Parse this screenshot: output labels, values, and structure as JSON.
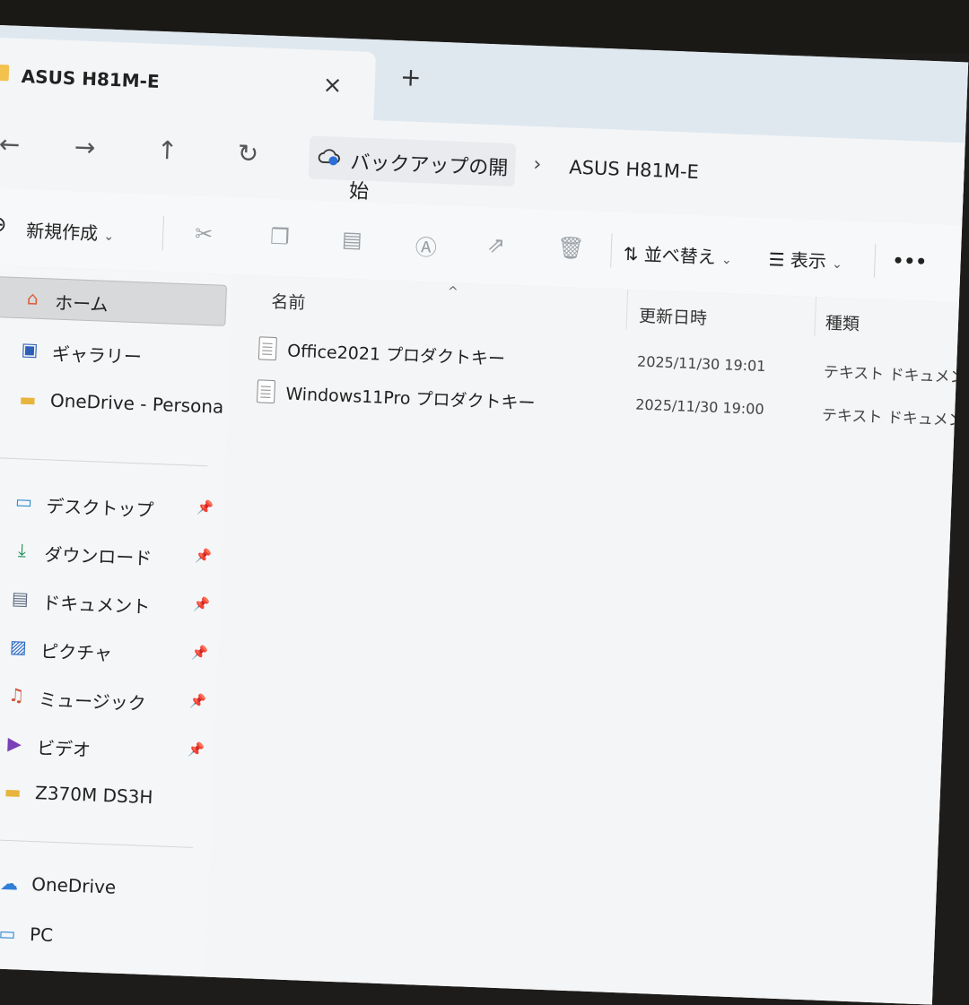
{
  "window": {
    "tab_title": "ASUS H81M-E",
    "tab_close": "×",
    "tab_new": "+"
  },
  "nav": {
    "back": "←",
    "forward": "→",
    "up": "↑",
    "refresh": "↻"
  },
  "address": {
    "crumbs": [
      "バックアップの開始",
      "ASUS H81M-E"
    ],
    "separator": "›"
  },
  "toolbar": {
    "new_label": "新規作成",
    "sort_label": "並べ替え",
    "view_label": "表示",
    "more_label": "•••",
    "chevron": "⌄"
  },
  "sidebar": {
    "items": [
      {
        "label": "ホーム",
        "icon": "home-icon"
      },
      {
        "label": "ギャラリー",
        "icon": "gallery-icon"
      },
      {
        "label": "OneDrive - Persona",
        "icon": "folder-icon"
      },
      {
        "label": "デスクトップ",
        "icon": "desktop-icon"
      },
      {
        "label": "ダウンロード",
        "icon": "download-icon"
      },
      {
        "label": "ドキュメント",
        "icon": "document-icon"
      },
      {
        "label": "ピクチャ",
        "icon": "pictures-icon"
      },
      {
        "label": "ミュージック",
        "icon": "music-icon"
      },
      {
        "label": "ビデオ",
        "icon": "video-icon"
      },
      {
        "label": "Z370M DS3H",
        "icon": "folder-icon"
      },
      {
        "label": "OneDrive",
        "icon": "cloud-icon"
      },
      {
        "label": "PC",
        "icon": "pc-icon"
      }
    ]
  },
  "columns": {
    "name": "名前",
    "modified": "更新日時",
    "type": "種類"
  },
  "files": [
    {
      "name": "Office2021 プロダクトキー",
      "modified": "2025/11/30 19:01",
      "type": "テキスト ドキュメント"
    },
    {
      "name": "Windows11Pro プロダクトキー",
      "modified": "2025/11/30 19:00",
      "type": "テキスト ドキュメント"
    }
  ]
}
